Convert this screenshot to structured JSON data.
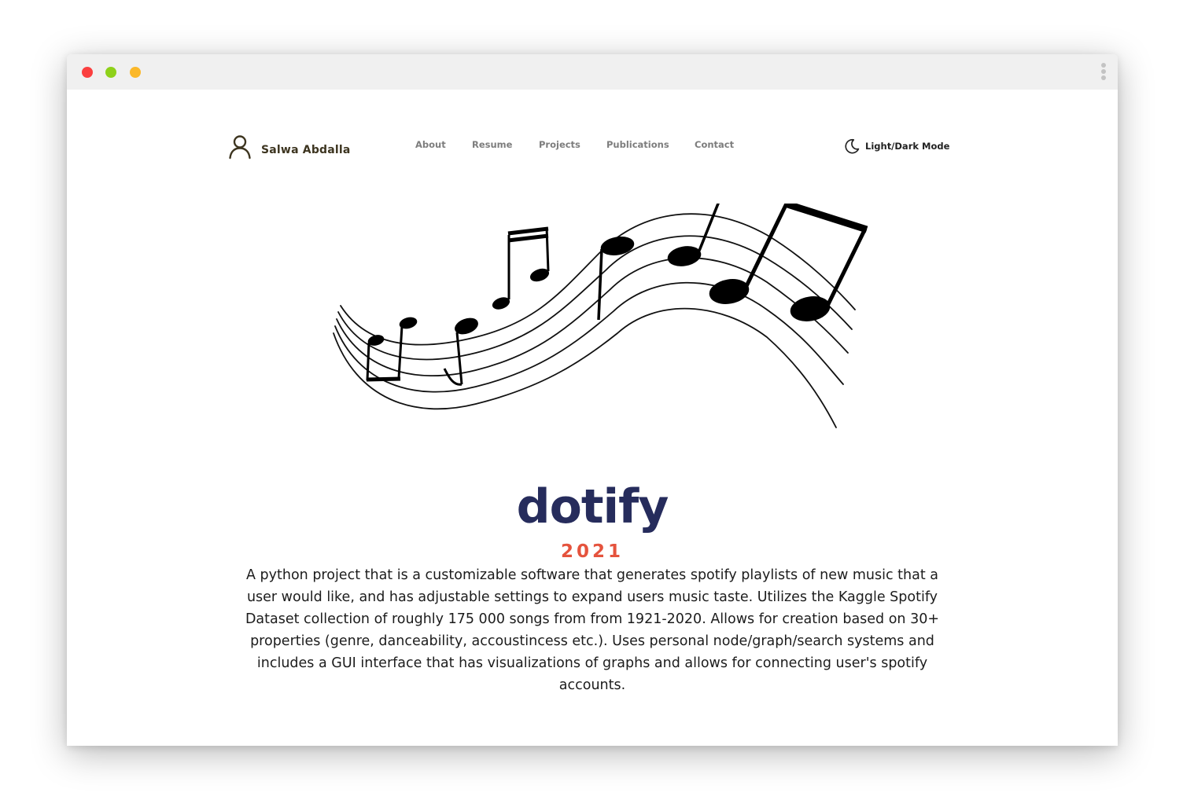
{
  "window": {
    "controls": [
      "close",
      "minimize",
      "maximize"
    ],
    "menu_icon": "kebab-menu-icon"
  },
  "nav": {
    "brand": {
      "icon": "person-icon",
      "name": "Salwa Abdalla"
    },
    "links": [
      "About",
      "Resume",
      "Projects",
      "Publications",
      "Contact"
    ],
    "mode_toggle": {
      "icon": "moon-icon",
      "label": "Light/Dark Mode"
    }
  },
  "project": {
    "image": "music-staff-notes-illustration",
    "title": "dotify",
    "year": "2021",
    "description": "A python project that is a customizable software that generates spotify playlists of new music that a user would like, and has adjustable settings to expand users music taste. Utilizes the Kaggle Spotify Dataset collection of roughly 175 000 songs from from 1921-2020. Allows for creation based on 30+ properties (genre, danceability, accoustincess etc.). Uses personal node/graph/search systems and includes a GUI interface that has visualizations of graphs and allows for connecting user's spotify accounts."
  },
  "colors": {
    "title": "#262c5c",
    "year": "#e5533d",
    "brand_text": "#3d3520",
    "nav_link": "#7d7d7d",
    "close_dot": "#fb3f3f",
    "min_dot": "#8ed11a",
    "max_dot": "#fbb829"
  }
}
